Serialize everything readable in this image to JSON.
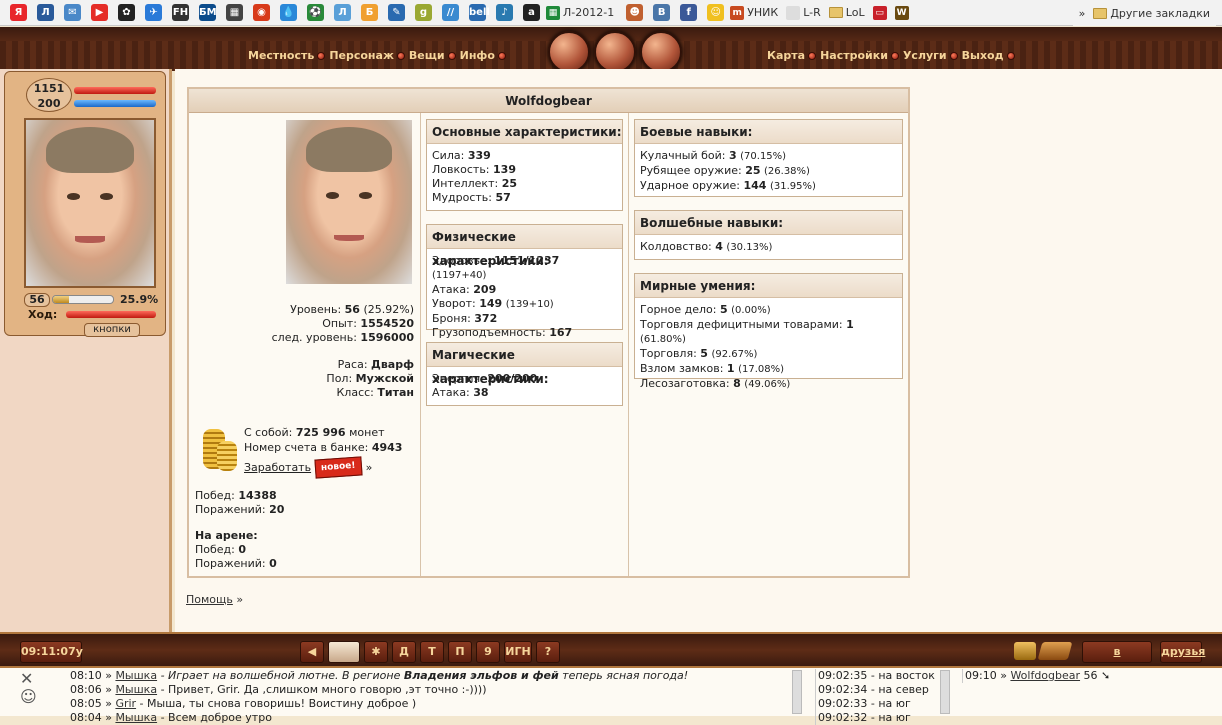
{
  "bookmarks": {
    "items": [
      {
        "label": "Я",
        "color": "#e8262b"
      },
      {
        "label": "Л",
        "color": "#2a5a9a"
      },
      {
        "label": "✉",
        "color": "#4a88c8"
      },
      {
        "label": "▶",
        "color": "#e52d27"
      },
      {
        "label": "✿",
        "color": "#222"
      },
      {
        "label": "✈",
        "color": "#2a7ad8"
      },
      {
        "label": "FH",
        "color": "#333"
      },
      {
        "label": "БМ",
        "color": "#0c4c8c"
      },
      {
        "label": "▦",
        "color": "#444"
      },
      {
        "label": "◉",
        "color": "#d83a1a"
      },
      {
        "label": "💧",
        "color": "#2a88d8"
      },
      {
        "label": "⚽",
        "color": "#2a8a3a"
      },
      {
        "label": "Л",
        "color": "#5aa0d8"
      },
      {
        "label": "Б",
        "color": "#f0a030"
      },
      {
        "label": "✎",
        "color": "#2a6ab0"
      },
      {
        "label": "g",
        "color": "#9aa833"
      },
      {
        "label": "//",
        "color": "#3a8ad0"
      },
      {
        "label": "bell",
        "color": "#2a6ab0"
      },
      {
        "label": "♪",
        "color": "#2a7ab0"
      },
      {
        "label": "a",
        "color": "#222"
      }
    ],
    "named": [
      {
        "label": "Л-2012-1",
        "icon": "spreadsheet-icon",
        "color": "#1f8a3a"
      }
    ],
    "more": [
      {
        "icon": "person-icon",
        "color": "#c06030"
      },
      {
        "label": "В",
        "color": "#4a76a8"
      },
      {
        "label": "f",
        "color": "#3b5998"
      },
      {
        "icon": "smile-icon",
        "color": "#f0c020"
      }
    ],
    "tail": [
      {
        "label": "УНИК",
        "icon": "tm-icon"
      },
      {
        "label": "L-R",
        "icon": "page-icon"
      },
      {
        "label": "LoL",
        "icon": "folder-icon"
      },
      {
        "icon": "tv-icon"
      },
      {
        "icon": "wow-icon"
      }
    ],
    "overflow": "»",
    "other": "Другие закладки"
  },
  "topnav": {
    "left": [
      "Местность",
      "Персонаж",
      "Вещи",
      "Инфо"
    ],
    "right": [
      "Карта",
      "Настройки",
      "Услуги",
      "Выход"
    ]
  },
  "sidebar": {
    "hp": "1151",
    "mp": "200",
    "level": "56",
    "level_pct": "25.9%",
    "turn_label": "Ход:",
    "buttons_label": "кнопки",
    "exp_fill": 0.259
  },
  "profile": {
    "name": "Wolfdogbear",
    "level_label": "Уровень:",
    "level": "56",
    "level_pct": "(25.92%)",
    "exp_label": "Опыт:",
    "exp": "1554520",
    "next_label": "след. уровень:",
    "next": "1596000",
    "race_label": "Раса:",
    "race": "Дварф",
    "sex_label": "Пол:",
    "sex": "Мужской",
    "class_label": "Класс:",
    "class": "Титан",
    "money_label": "С собой:",
    "money": "725 996",
    "money_unit": "монет",
    "bank_label": "Номер счета в банке:",
    "bank": "4943",
    "earn": "Заработать",
    "new_badge": "новое!",
    "earn_arrow": "»",
    "wins_label": "Побед:",
    "wins": "14388",
    "losses_label": "Поражений:",
    "losses": "20",
    "arena_label": "На арене:",
    "arena_wins_label": "Побед:",
    "arena_wins": "0",
    "arena_losses_label": "Поражений:",
    "arena_losses": "0"
  },
  "stats": {
    "basic": {
      "title": "Основные характеристики:",
      "rows": [
        {
          "k": "Сила:",
          "v": "339",
          "x": ""
        },
        {
          "k": "Ловкость:",
          "v": "139",
          "x": ""
        },
        {
          "k": "Интеллект:",
          "v": "25",
          "x": ""
        },
        {
          "k": "Мудрость:",
          "v": "57",
          "x": ""
        }
      ]
    },
    "phys": {
      "title": "Физические характеристики:",
      "rows": [
        {
          "k": "Здоровье:",
          "v": "1151/1237",
          "x": "(1197+40)"
        },
        {
          "k": "Атака:",
          "v": "209",
          "x": ""
        },
        {
          "k": "Уворот:",
          "v": "149",
          "x": "(139+10)"
        },
        {
          "k": "Броня:",
          "v": "372",
          "x": ""
        },
        {
          "k": "Грузоподъемность:",
          "v": "167",
          "x": ""
        }
      ]
    },
    "magic": {
      "title": "Магические характеристики:",
      "rows": [
        {
          "k": "Энергия:",
          "v": "200/200",
          "x": ""
        },
        {
          "k": "Атака:",
          "v": "38",
          "x": ""
        }
      ]
    },
    "combat": {
      "title": "Боевые навыки:",
      "rows": [
        {
          "k": "Кулачный бой:",
          "v": "3",
          "x": "(70.15%)"
        },
        {
          "k": "Рубящее оружие:",
          "v": "25",
          "x": "(26.38%)"
        },
        {
          "k": "Ударное оружие:",
          "v": "144",
          "x": "(31.95%)"
        }
      ]
    },
    "magicskill": {
      "title": "Волшебные навыки:",
      "rows": [
        {
          "k": "Колдовство:",
          "v": "4",
          "x": "(30.13%)"
        }
      ]
    },
    "peace": {
      "title": "Мирные умения:",
      "rows": [
        {
          "k": "Горное дело:",
          "v": "5",
          "x": "(0.00%)"
        },
        {
          "k": "Торговля дефицитными товарами:",
          "v": "1",
          "x": "(61.80%)"
        },
        {
          "k": "Торговля:",
          "v": "5",
          "x": "(92.67%)"
        },
        {
          "k": "Взлом замков:",
          "v": "1",
          "x": "(17.08%)"
        },
        {
          "k": "Лесозаготовка:",
          "v": "8",
          "x": "(49.06%)"
        }
      ]
    }
  },
  "help": {
    "label": "Помощь",
    "arrow": "»"
  },
  "bottom": {
    "clock": "09:11:07у",
    "buttons": [
      "◀",
      "",
      "✱",
      "Д",
      "Т",
      "П",
      "9",
      "ИГН",
      "?"
    ],
    "loc": "в местности",
    "friends": "друзья"
  },
  "chat": {
    "lines": [
      {
        "time": "08:10",
        "user": "Мышка",
        "text": " - Играет на волшебной лютне. В регионе ",
        "bold": "Владения эльфов и фей",
        "tail": " теперь ясная погода!",
        "italic": true
      },
      {
        "time": "08:06",
        "user": "Мышка",
        "text": " - Привет, Grir. Да ,слишком много говорю ,эт точно :-))))",
        "bold": "",
        "tail": "",
        "italic": false
      },
      {
        "time": "08:05",
        "user": "Grir",
        "text": " - Мыша, ты снова говоришь! Воистину доброе )",
        "bold": "",
        "tail": "",
        "italic": false
      },
      {
        "time": "08:04",
        "user": "Мышка",
        "text": " - Всем доброе утро",
        "bold": "",
        "tail": "",
        "italic": false
      }
    ],
    "log": [
      "09:02:35 - на восток",
      "09:02:34 - на север",
      "09:02:33 - на юг",
      "09:02:32 - на юг"
    ],
    "users": [
      {
        "time": "09:10",
        "user": "Wolfdogbear",
        "level": "56"
      }
    ]
  }
}
